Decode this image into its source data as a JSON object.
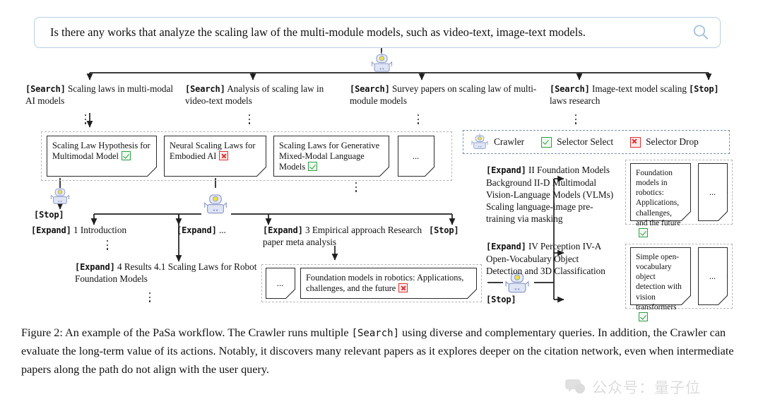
{
  "search": {
    "query": "Is there any works that analyze the scaling law of the multi-module models, such as video-text, image-text models.",
    "icon": "search-icon"
  },
  "legend": {
    "items": [
      {
        "icon": "robot-icon",
        "label": "Crawler"
      },
      {
        "icon": "green-check-icon",
        "label": "Selector Select"
      },
      {
        "icon": "red-x-icon",
        "label": "Selector Drop"
      }
    ]
  },
  "root_actions": [
    {
      "kw": "[Search]",
      "text": "Scaling laws in multi-modal AI models"
    },
    {
      "kw": "[Search]",
      "text": "Analysis of scaling law in video-text models"
    },
    {
      "kw": "[Search]",
      "text": "Survey papers on scaling law of multi-module models"
    },
    {
      "kw": "[Search]",
      "text": "Image-text model scaling laws research"
    },
    {
      "kw": "[Stop]",
      "text": ""
    }
  ],
  "papers_row1": [
    {
      "title": "Scaling Law Hypothesis for Multimodal Model",
      "mark": "check"
    },
    {
      "title": "Neural Scaling Laws for Embodied AI",
      "mark": "x"
    },
    {
      "title": "Scaling Laws for Generative Mixed-Modal Language Models",
      "mark": "check"
    },
    {
      "title": "...",
      "mark": "none"
    }
  ],
  "level2_actions": [
    {
      "kw": "[Stop]",
      "text": ""
    },
    {
      "kw": "[Expand]",
      "text": "1 Introduction"
    },
    {
      "kw": "[Expand]",
      "text": "..."
    },
    {
      "kw": "[Expand]",
      "text": "3 Empirical approach Research paper meta analysis"
    },
    {
      "kw": "[Stop]",
      "text": ""
    },
    {
      "kw": "[Expand]",
      "text": "4 Results 4.1 Scaling Laws for Robot Foundation Models"
    }
  ],
  "papers_row2": [
    {
      "title": "...",
      "mark": "none"
    },
    {
      "title": "Foundation models in robotics: Applications, challenges, and the future",
      "mark": "x"
    }
  ],
  "level3_actions": [
    {
      "kw": "[Expand]",
      "text": "II Foundation Models Background II-D Multimodal Vision-Language Models (VLMs) Scaling language-image pre-training via masking"
    },
    {
      "kw": "[Expand]",
      "text": "IV Perception IV-A Open-Vocabulary Object Detection and 3D Classification"
    },
    {
      "kw": "[Stop]",
      "text": ""
    }
  ],
  "papers_row3": [
    {
      "title": "Foundation models in robotics: Applications, challenges, and the future",
      "mark": "check"
    },
    {
      "title": "...",
      "mark": "none"
    }
  ],
  "papers_row4": [
    {
      "title": "Simple open-vocabulary object detection with vision transformers",
      "mark": "check"
    },
    {
      "title": "...",
      "mark": "none"
    }
  ],
  "caption": {
    "label": "Figure 2:",
    "part1": " An example of the PaSa workflow. The Crawler runs multiple ",
    "mono": "[Search]",
    "part2": " using diverse and complementary queries. In addition, the Crawler can evaluate the long-term value of its actions. Notably, it discovers many relevant papers as it explores deeper on the citation network, even when intermediate papers along the path do not align with the user query."
  },
  "watermark": {
    "text": "公众号：量子位"
  },
  "colors": {
    "search_border": "#b9cfe6",
    "search_icon": "#a8c4de",
    "robot": "#c3cce8",
    "select_green": "#2f9e44",
    "drop_red": "#e03131",
    "dash_gray": "#b8b8b8",
    "dash_blue": "#7a8fa8",
    "line": "#1f1f1f"
  }
}
